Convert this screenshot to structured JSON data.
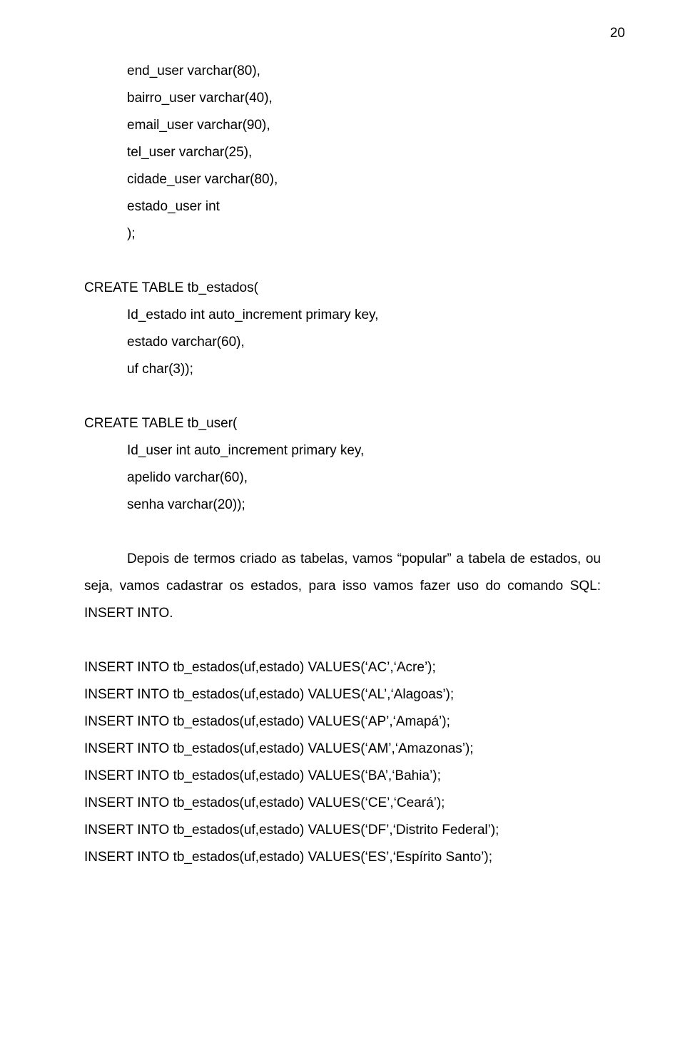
{
  "page_number": "20",
  "code1": {
    "lines": [
      "end_user varchar(80),",
      "bairro_user varchar(40),",
      "email_user varchar(90),",
      "tel_user varchar(25),",
      "cidade_user varchar(80),",
      "estado_user int",
      ");"
    ]
  },
  "code2": {
    "head": "CREATE TABLE tb_estados(",
    "lines": [
      "Id_estado int auto_increment primary key,",
      "estado varchar(60),",
      "uf char(3));"
    ]
  },
  "code3": {
    "head": "CREATE TABLE tb_user(",
    "lines": [
      "Id_user int auto_increment primary key,",
      "apelido varchar(60),",
      "senha varchar(20));"
    ]
  },
  "para1": "Depois de termos criado as tabelas, vamos “popular” a tabela de estados, ou seja, vamos cadastrar os estados, para isso vamos fazer uso do comando SQL: INSERT INTO.",
  "inserts": [
    "INSERT INTO tb_estados(uf,estado) VALUES(‘AC’,‘Acre’);",
    "INSERT INTO tb_estados(uf,estado) VALUES(‘AL’,‘Alagoas’);",
    "INSERT INTO tb_estados(uf,estado) VALUES(‘AP’,‘Amapá’);",
    "INSERT INTO tb_estados(uf,estado) VALUES(‘AM’,‘Amazonas’);",
    "INSERT INTO tb_estados(uf,estado) VALUES(‘BA’,‘Bahia’);",
    "INSERT INTO tb_estados(uf,estado) VALUES(‘CE’,‘Ceará’);",
    "INSERT INTO tb_estados(uf,estado) VALUES(‘DF’,‘Distrito Federal’);",
    "INSERT INTO tb_estados(uf,estado) VALUES(‘ES’,‘Espírito Santo’);"
  ]
}
